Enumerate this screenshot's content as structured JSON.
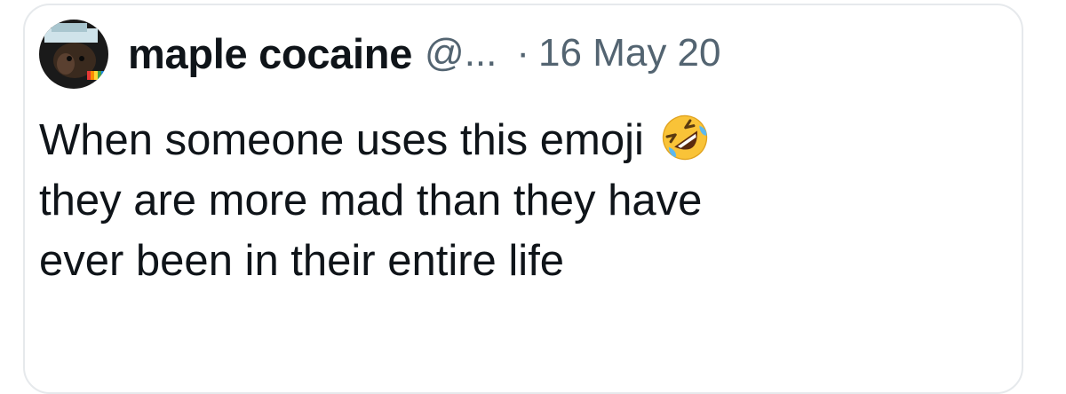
{
  "tweet": {
    "display_name": "maple cocaine",
    "handle": "@...",
    "separator": "·",
    "date": "16 May 20",
    "text_line_1": "When someone uses this emoji",
    "text_line_2": "they are more mad than they have",
    "text_line_3": "ever been in their entire life",
    "emoji_icon": "rolling-on-the-floor-laughing-icon"
  },
  "colors": {
    "text_primary": "#0f1419",
    "text_secondary": "#536471",
    "card_border": "#e6e9ec",
    "emoji_yellow": "#f9c338"
  }
}
